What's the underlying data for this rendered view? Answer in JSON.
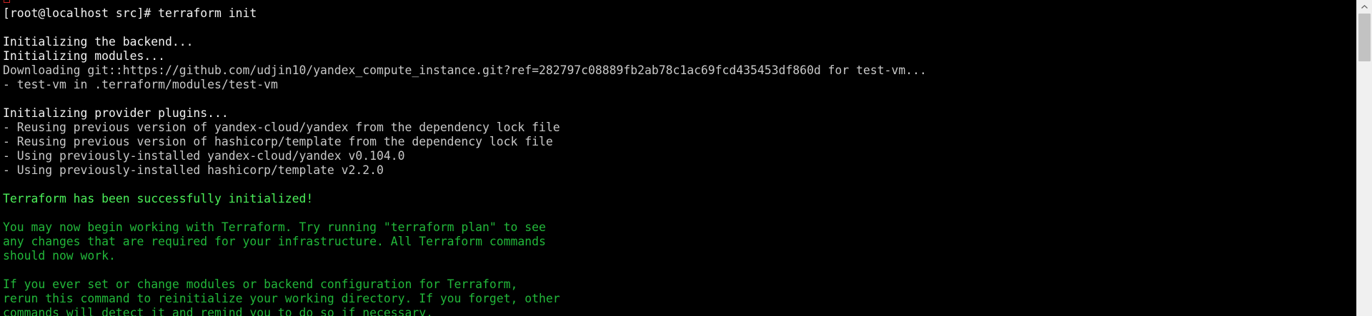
{
  "terminal": {
    "lines": [
      {
        "text": "[root@localhost src]# terraform init",
        "color": "white"
      },
      {
        "text": "",
        "color": "white"
      },
      {
        "text": "Initializing the backend...",
        "color": "white"
      },
      {
        "text": "Initializing modules...",
        "color": "white"
      },
      {
        "text": "Downloading git::https://github.com/udjin10/yandex_compute_instance.git?ref=282797c08889fb2ab78c1ac69fcd435453df860d for test-vm...",
        "color": "gray"
      },
      {
        "text": "- test-vm in .terraform/modules/test-vm",
        "color": "gray"
      },
      {
        "text": "",
        "color": "white"
      },
      {
        "text": "Initializing provider plugins...",
        "color": "white"
      },
      {
        "text": "- Reusing previous version of yandex-cloud/yandex from the dependency lock file",
        "color": "gray"
      },
      {
        "text": "- Reusing previous version of hashicorp/template from the dependency lock file",
        "color": "gray"
      },
      {
        "text": "- Using previously-installed yandex-cloud/yandex v0.104.0",
        "color": "gray"
      },
      {
        "text": "- Using previously-installed hashicorp/template v2.2.0",
        "color": "gray"
      },
      {
        "text": "",
        "color": "white"
      },
      {
        "text": "Terraform has been successfully initialized!",
        "color": "bright"
      },
      {
        "text": "",
        "color": "white"
      },
      {
        "text": "You may now begin working with Terraform. Try running \"terraform plan\" to see",
        "color": "green"
      },
      {
        "text": "any changes that are required for your infrastructure. All Terraform commands",
        "color": "green"
      },
      {
        "text": "should now work.",
        "color": "green"
      },
      {
        "text": "",
        "color": "white"
      },
      {
        "text": "If you ever set or change modules or backend configuration for Terraform,",
        "color": "green"
      },
      {
        "text": "rerun this command to reinitialize your working directory. If you forget, other",
        "color": "green"
      },
      {
        "text": "commands will detect it and remind you to do so if necessary.",
        "color": "green"
      }
    ]
  },
  "colors": {
    "background": "#000000",
    "white": "#f2f2f2",
    "gray": "#c8c8c8",
    "bright": "#4cf05a",
    "green": "#22b83a",
    "scrollbar_track": "#f0f0f0",
    "scrollbar_thumb": "#c2c2c2"
  },
  "scrollbar": {
    "up_icon": "chevron-up-icon"
  }
}
